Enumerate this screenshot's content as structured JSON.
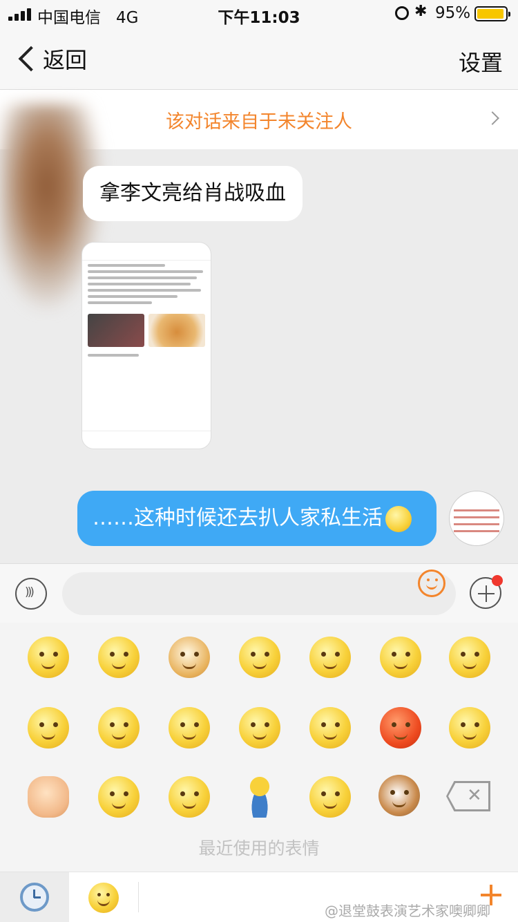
{
  "status_bar": {
    "carrier": "中国电信",
    "network": "4G",
    "time": "下午11:03",
    "battery_percent": "95%",
    "battery_level": 0.95
  },
  "nav": {
    "back_label": "返回",
    "settings_label": "设置"
  },
  "banner": {
    "text": "该对话来自于未关注人"
  },
  "messages": {
    "incoming_text": "拿李文亮给肖战吸血",
    "outgoing_text": "……这种时候还去扒人家私生活"
  },
  "emoji_panel": {
    "caption": "最近使用的表情",
    "icons": [
      "watermelon-eating-emoji",
      "shy-emoji",
      "doge-emoji",
      "facepalm-laugh-emoji",
      "confused-emoji",
      "sad-emoji",
      "eye-roll-emoji",
      "question-emoji",
      "speechless-emoji",
      "glasses-emoji",
      "laugh-cry-emoji",
      "thinking-emoji",
      "angry-emoji",
      "vomit-emoji",
      "fist-emoji",
      "pitiful-emoji",
      "mouth-shut-emoji",
      "sitting-man-emoji",
      "sweat-emoji",
      "cat-emoji"
    ]
  },
  "watermark": "@退堂鼓表演艺术家噢卿卿",
  "colors": {
    "accent": "#f3852c",
    "bubble_blue": "#3fa9f5",
    "notification_red": "#f0382e"
  }
}
